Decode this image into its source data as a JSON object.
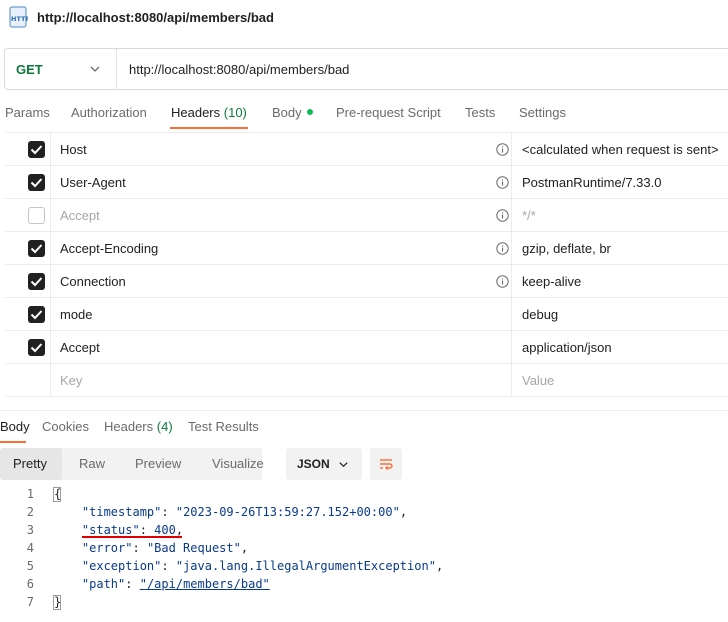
{
  "window": {
    "title": "http://localhost:8080/api/members/bad",
    "icon": "http-icon"
  },
  "request": {
    "method": "GET",
    "url": "http://localhost:8080/api/members/bad"
  },
  "request_tabs": [
    {
      "label": "Params"
    },
    {
      "label": "Authorization"
    },
    {
      "label": "Headers",
      "count": "(10)",
      "active": true
    },
    {
      "label": "Body",
      "dot": true
    },
    {
      "label": "Pre-request Script"
    },
    {
      "label": "Tests"
    },
    {
      "label": "Settings"
    }
  ],
  "headers": {
    "rows": [
      {
        "checked": true,
        "key": "Host",
        "value": "<calculated when request is sent>",
        "info": true
      },
      {
        "checked": true,
        "key": "User-Agent",
        "value": "PostmanRuntime/7.33.0",
        "info": true
      },
      {
        "checked": false,
        "key": "Accept",
        "value": "*/*",
        "info": true
      },
      {
        "checked": true,
        "key": "Accept-Encoding",
        "value": "gzip, deflate, br",
        "info": true
      },
      {
        "checked": true,
        "key": "Connection",
        "value": "keep-alive",
        "info": true
      },
      {
        "checked": true,
        "key": "mode",
        "value": "debug",
        "info": false
      },
      {
        "checked": true,
        "key": "Accept",
        "value": "application/json",
        "info": false
      }
    ],
    "key_placeholder": "Key",
    "value_placeholder": "Value"
  },
  "response_tabs": [
    {
      "label": "Body",
      "active": true
    },
    {
      "label": "Cookies"
    },
    {
      "label": "Headers",
      "count": "(4)"
    },
    {
      "label": "Test Results"
    }
  ],
  "view_modes": [
    "Pretty",
    "Raw",
    "Preview",
    "Visualize"
  ],
  "format": "JSON",
  "response_body": {
    "line_numbers": [
      "1",
      "2",
      "3",
      "4",
      "5",
      "6",
      "7"
    ],
    "open_brace": "{",
    "close_brace": "}",
    "fields": [
      {
        "key": "\"timestamp\"",
        "value": "\"2023-09-26T13:59:27.152+00:00\"",
        "comma": ","
      },
      {
        "key": "\"status\"",
        "value": "400",
        "comma": ","
      },
      {
        "key": "\"error\"",
        "value": "\"Bad Request\"",
        "comma": ","
      },
      {
        "key": "\"exception\"",
        "value": "\"java.lang.IllegalArgumentException\"",
        "comma": ","
      },
      {
        "key": "\"path\"",
        "value": "\"/api/members/bad\"",
        "comma": ""
      }
    ]
  },
  "colors": {
    "accent": "#ff6c37",
    "method_get": "#0c7a3c",
    "json_text": "#0a3a8c",
    "annotation": "#e00000"
  }
}
